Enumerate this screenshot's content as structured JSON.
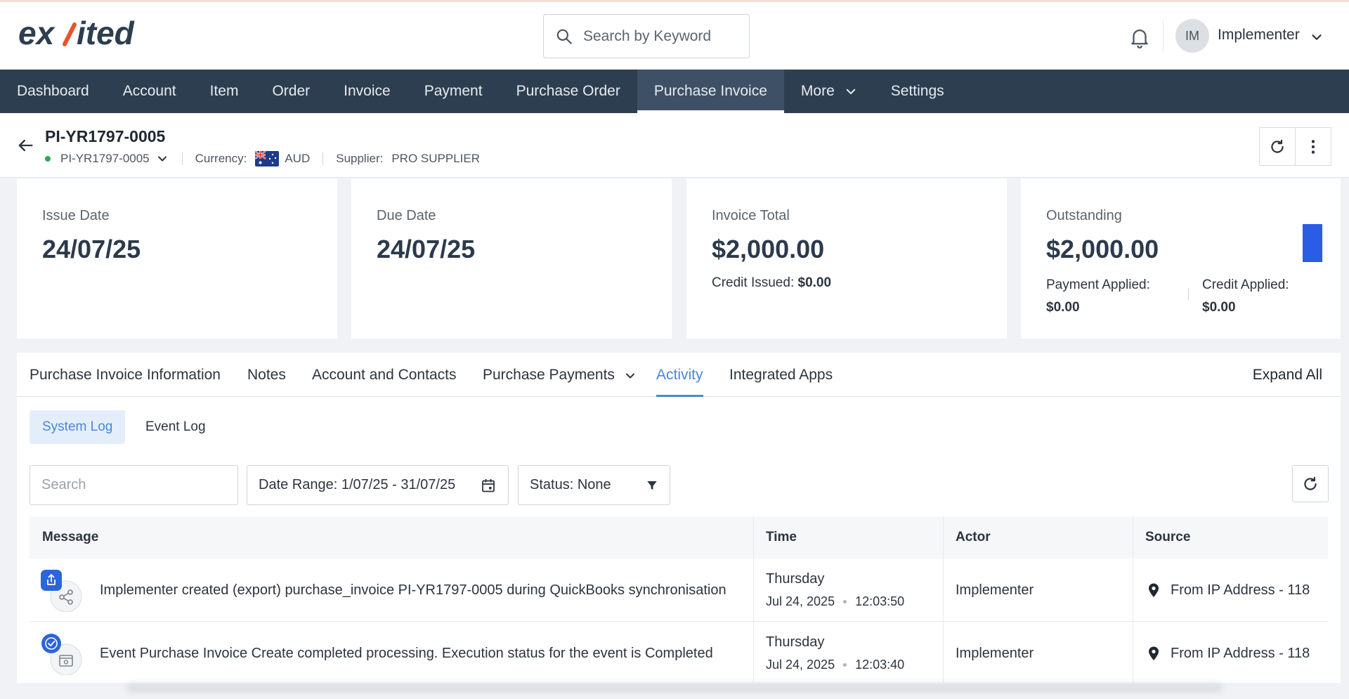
{
  "brand": {
    "logo_text": "exsited"
  },
  "header": {
    "search_placeholder": "Search by Keyword",
    "user_initials": "IM",
    "user_name": "Implementer"
  },
  "nav": {
    "items": [
      "Dashboard",
      "Account",
      "Item",
      "Order",
      "Invoice",
      "Payment",
      "Purchase Order",
      "Purchase Invoice",
      "More",
      "Settings"
    ],
    "active": "Purchase Invoice"
  },
  "record": {
    "title": "PI-YR1797-0005",
    "id": "PI-YR1797-0005",
    "currency_label": "Currency:",
    "currency": "AUD",
    "supplier_label": "Supplier:",
    "supplier": "PRO SUPPLIER"
  },
  "cards": {
    "issue": {
      "label": "Issue Date",
      "value": "24/07/25"
    },
    "due": {
      "label": "Due Date",
      "value": "24/07/25"
    },
    "total": {
      "label": "Invoice Total",
      "value": "$2,000.00",
      "credit_label": "Credit Issued:",
      "credit_value": "$0.00"
    },
    "outstanding": {
      "label": "Outstanding",
      "value": "$2,000.00",
      "payment_label": "Payment Applied:",
      "payment_value": "$0.00",
      "credit_label": "Credit Applied:",
      "credit_value": "$0.00"
    }
  },
  "tabs": {
    "items": [
      "Purchase Invoice Information",
      "Notes",
      "Account and Contacts",
      "Purchase Payments",
      "Activity",
      "Integrated Apps"
    ],
    "active": "Activity",
    "expand_all": "Expand All"
  },
  "subtabs": {
    "system_log": "System Log",
    "event_log": "Event Log"
  },
  "filters": {
    "search_placeholder": "Search",
    "date_range": "Date Range: 1/07/25 - 31/07/25",
    "status": "Status: None"
  },
  "table": {
    "headers": [
      "Message",
      "Time",
      "Actor",
      "Source"
    ],
    "rows": [
      {
        "message": "Implementer created (export) purchase_invoice PI-YR1797-0005 during QuickBooks synchronisation",
        "day": "Thursday",
        "date": "Jul 24, 2025",
        "time": "12:03:50",
        "actor": "Implementer",
        "source": "From IP Address - 118",
        "badge": "export-icon",
        "icon": "share-icon"
      },
      {
        "message": "Event Purchase Invoice Create completed processing. Execution status for the event is Completed",
        "day": "Thursday",
        "date": "Jul 24, 2025",
        "time": "12:03:40",
        "actor": "Implementer",
        "source": "From IP Address - 118",
        "badge": "check-icon",
        "icon": "calendar-event-icon"
      }
    ]
  },
  "colors": {
    "nav_bg": "#2d3e50",
    "accent": "#4a86d6",
    "outstanding_bar": "#2b5ce6"
  }
}
